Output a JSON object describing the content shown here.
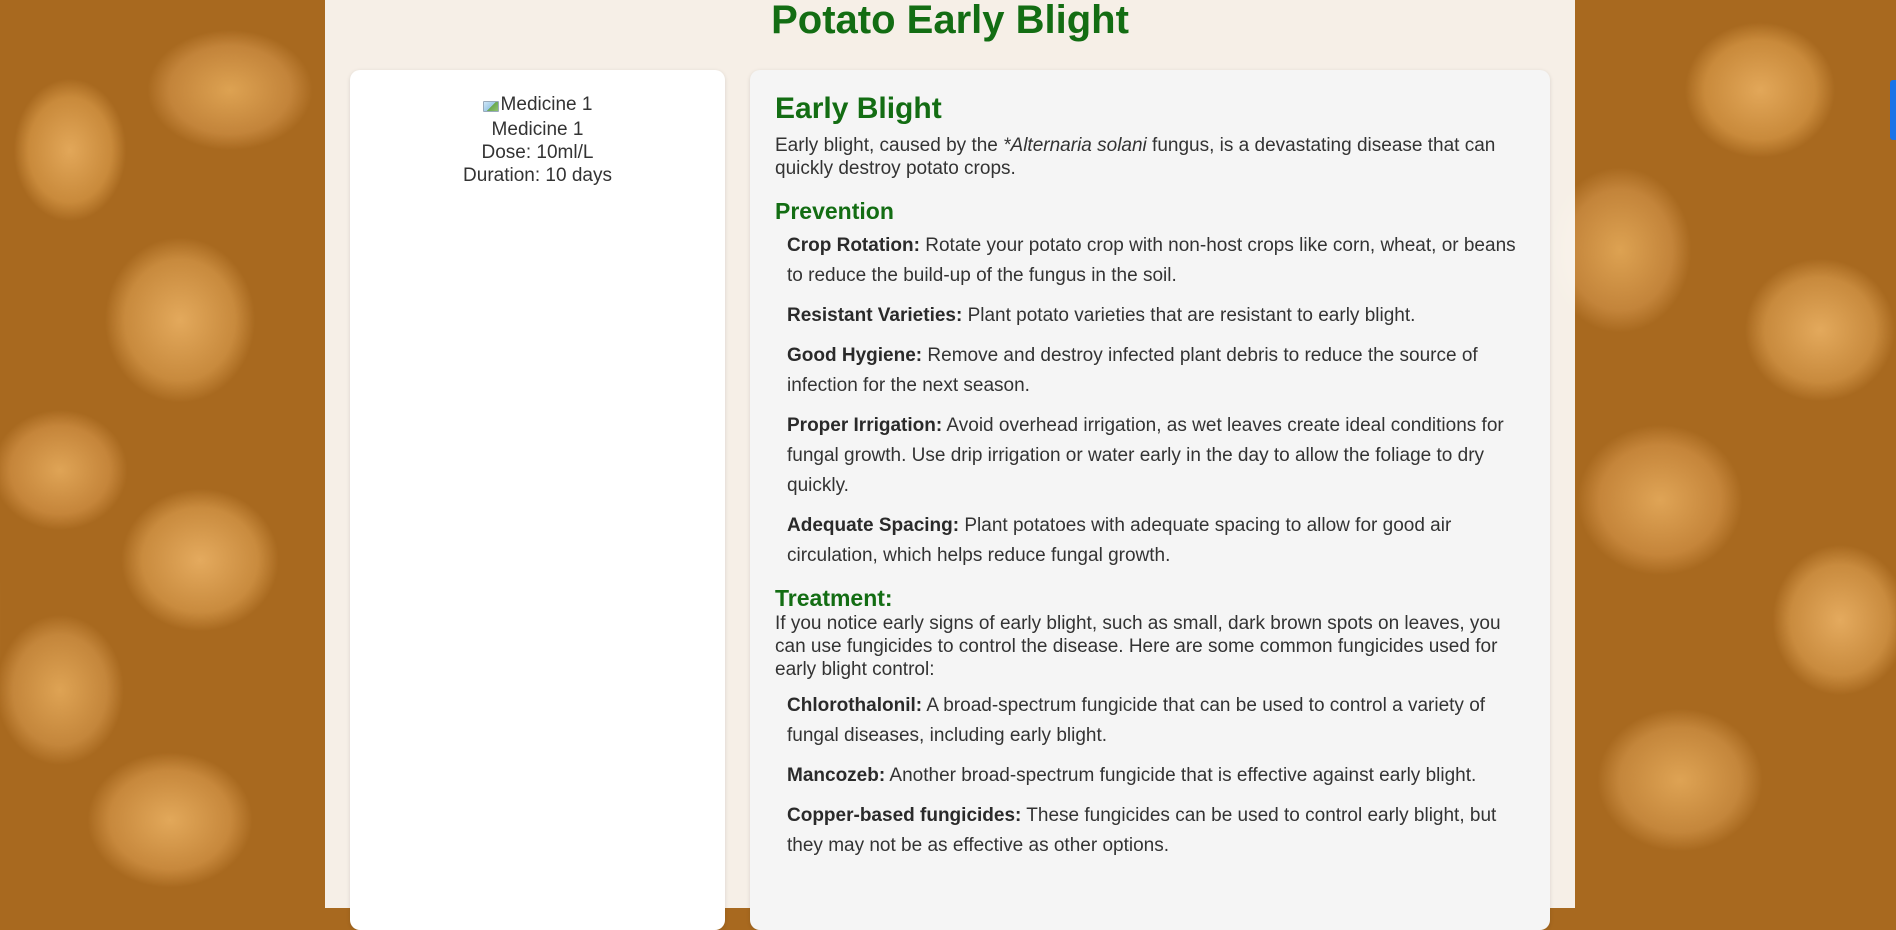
{
  "page": {
    "title": "Potato Early Blight"
  },
  "medicine": {
    "image_alt": "Medicine 1",
    "name": "Medicine 1",
    "dose": "Dose: 10ml/L",
    "duration": "Duration: 10 days"
  },
  "disease": {
    "heading": "Early Blight",
    "intro_before": "Early blight, caused by the ",
    "intro_italic": "*Alternaria solani",
    "intro_after": " fungus, is a devastating disease that can quickly destroy potato crops.",
    "prevention_heading": "Prevention",
    "prevention": [
      {
        "term": "Crop Rotation:",
        "text": " Rotate your potato crop with non-host crops like corn, wheat, or beans to reduce the build-up of the fungus in the soil."
      },
      {
        "term": "Resistant Varieties:",
        "text": " Plant potato varieties that are resistant to early blight."
      },
      {
        "term": "Good Hygiene:",
        "text": " Remove and destroy infected plant debris to reduce the source of infection for the next season."
      },
      {
        "term": "Proper Irrigation:",
        "text": " Avoid overhead irrigation, as wet leaves create ideal conditions for fungal growth. Use drip irrigation or water early in the day to allow the foliage to dry quickly."
      },
      {
        "term": "Adequate Spacing:",
        "text": " Plant potatoes with adequate spacing to allow for good air circulation, which helps reduce fungal growth."
      }
    ],
    "treatment_heading": "Treatment:",
    "treatment_intro": "If you notice early signs of early blight, such as small, dark brown spots on leaves, you can use fungicides to control the disease. Here are some common fungicides used for early blight control:",
    "treatment": [
      {
        "term": "Chlorothalonil:",
        "text": " A broad-spectrum fungicide that can be used to control a variety of fungal diseases, including early blight."
      },
      {
        "term": "Mancozeb:",
        "text": " Another broad-spectrum fungicide that is effective against early blight."
      },
      {
        "term": "Copper-based fungicides:",
        "text": " These fungicides can be used to control early blight, but they may not be as effective as other options."
      }
    ]
  },
  "colors": {
    "heading_green": "#136d13",
    "text": "#333333",
    "accent_blue": "#1a73e8"
  }
}
